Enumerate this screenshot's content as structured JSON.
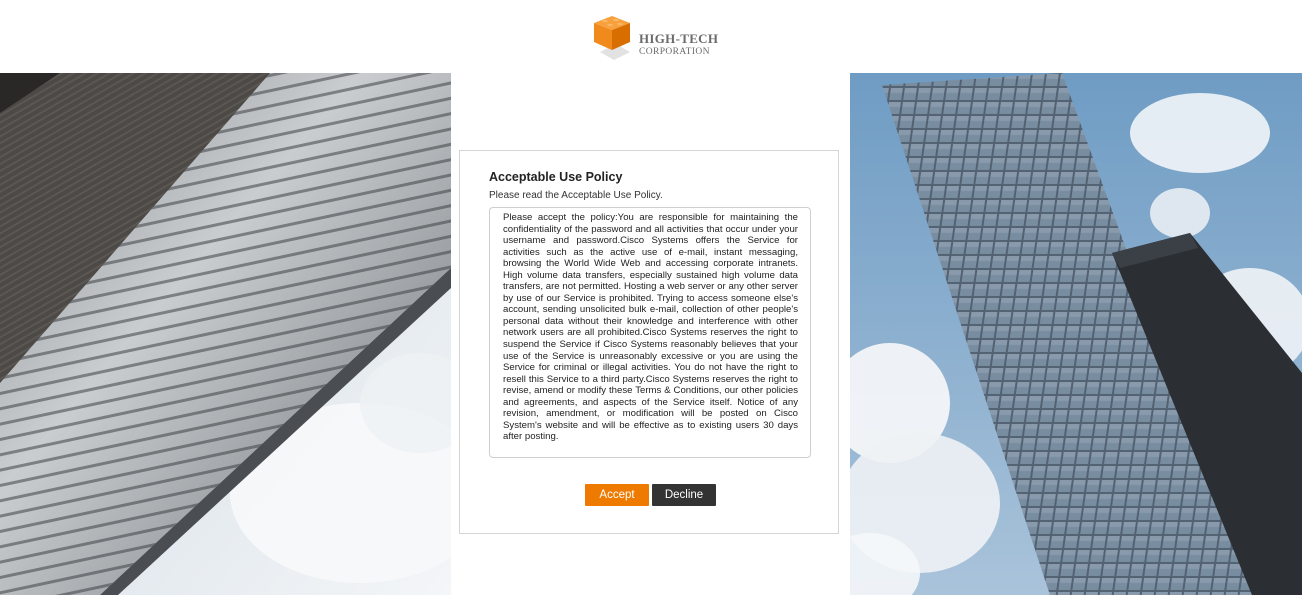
{
  "brand": {
    "line1": "HIGH-TECH",
    "line2": "CORPORATION",
    "accent_color": "#ee7b00"
  },
  "policy": {
    "title": "Acceptable Use Policy",
    "subtitle": "Please read the Acceptable Use Policy.",
    "body": "Please accept the policy:You are responsible for maintaining the confidentiality of the password and all activities that occur under your username and password.Cisco Systems offers the Service for activities such as the active use of e-mail, instant messaging, browsing the World Wide Web and accessing corporate intranets. High volume data transfers, especially sustained high volume data transfers, are not permitted. Hosting a web server or any other server by use of our Service is prohibited. Trying to access someone else's account, sending unsolicited bulk e-mail, collection of other people's personal data without their knowledge and interference with other network users are all prohibited.Cisco Systems reserves the right to suspend the Service if Cisco Systems reasonably believes that your use of the Service is unreasonably excessive or you are using the Service for criminal or illegal activities. You do not have the right to resell this Service to a third party.Cisco Systems reserves the right to revise, amend or modify these Terms & Conditions, our other policies and agreements, and aspects of the Service itself. Notice of any revision, amendment, or modification will be posted on Cisco System's website and will be effective as to existing users 30 days after posting."
  },
  "actions": {
    "accept_label": "Accept",
    "decline_label": "Decline",
    "accept_color": "#ee7b00",
    "decline_color": "#333333"
  }
}
